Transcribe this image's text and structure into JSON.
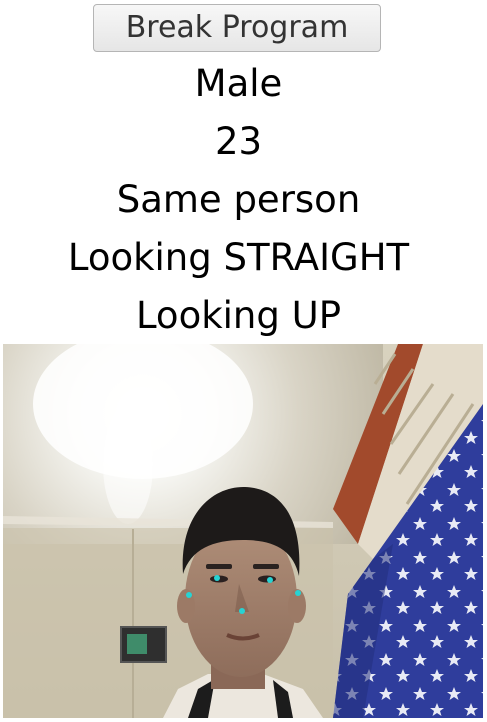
{
  "controls": {
    "break_button_label": "Break Program"
  },
  "results": {
    "gender": "Male",
    "age": "23",
    "identity": "Same person",
    "horizontal_gaze": "Looking STRAIGHT",
    "vertical_gaze": "Looking UP"
  },
  "colors": {
    "landmark": "#27d3d3",
    "flag_blue": "#2f3d9c",
    "curtain_red": "#a24a2c"
  }
}
